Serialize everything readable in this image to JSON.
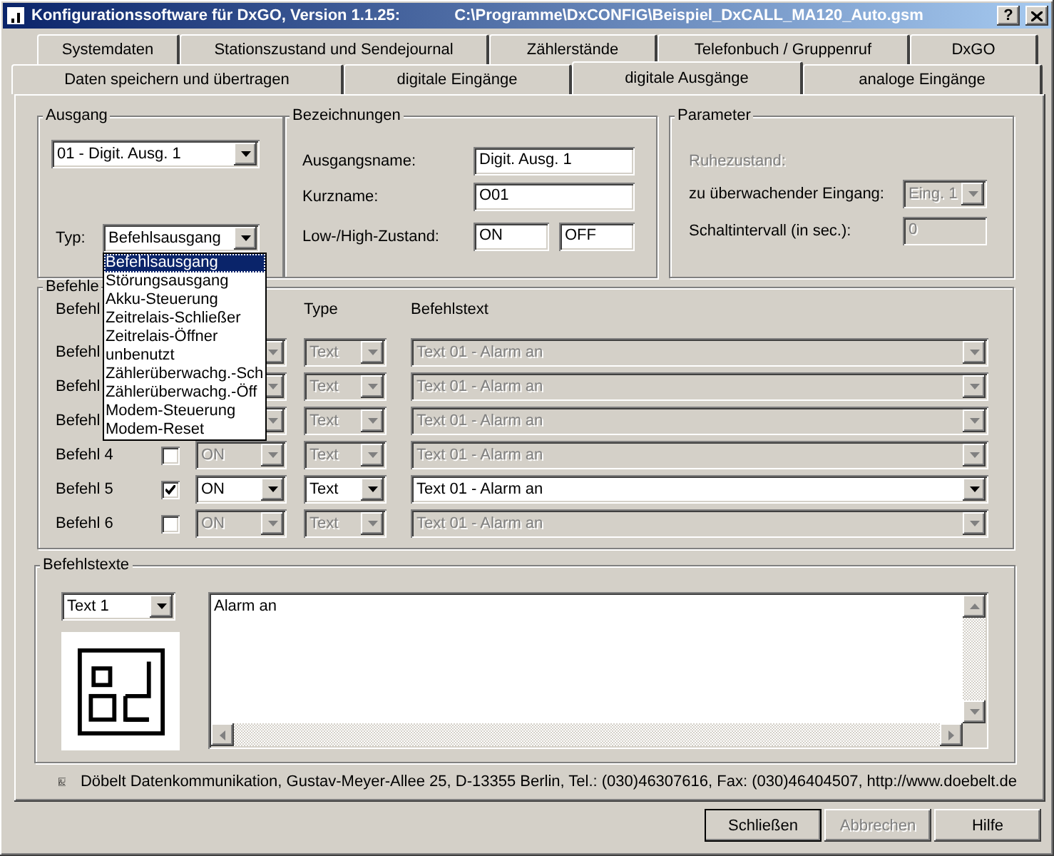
{
  "window": {
    "title": "Konfigurationssoftware für DxGO, Version 1.1.25:",
    "path": "C:\\Programme\\DxCONFIG\\Beispiel_DxCALL_MA120_Auto.gsm",
    "controls": [
      {
        "kind": "help",
        "label": "?"
      },
      {
        "kind": "close"
      }
    ]
  },
  "tabs": [
    [
      {
        "label": "Systemdaten",
        "selected": false
      },
      {
        "label": "Stationszustand und Sendejournal",
        "selected": false
      },
      {
        "label": "Zählerstände",
        "selected": false
      },
      {
        "label": "Telefonbuch / Gruppenruf",
        "selected": false
      },
      {
        "label": "DxGO",
        "selected": false
      }
    ],
    [
      {
        "label": "Daten speichern und übertragen",
        "selected": false
      },
      {
        "label": "digitale Eingänge",
        "selected": false
      },
      {
        "label": "digitale Ausgänge",
        "selected": true
      },
      {
        "label": "analoge Eingänge",
        "selected": false
      }
    ]
  ],
  "ausgang": {
    "title": "Ausgang",
    "output": "01 - Digit. Ausg. 1",
    "type_label": "Typ:",
    "type": "Befehlsausgang",
    "type_expanded": true,
    "type_options": [
      {
        "label": "Befehlsausgang",
        "selected": true
      },
      {
        "label": "Störungsausgang",
        "selected": false
      },
      {
        "label": "Akku-Steuerung",
        "selected": false
      },
      {
        "label": "Zeitrelais-Schließer",
        "selected": false
      },
      {
        "label": "Zeitrelais-Öffner",
        "selected": false
      },
      {
        "label": "unbenutzt",
        "selected": false
      },
      {
        "label": "Zählerüberwachg.-Sch",
        "selected": false
      },
      {
        "label": "Zählerüberwachg.-Öff",
        "selected": false
      },
      {
        "label": "Modem-Steuerung",
        "selected": false
      },
      {
        "label": "Modem-Reset",
        "selected": false
      }
    ]
  },
  "bezeichnungen": {
    "title": "Bezeichnungen",
    "fields": [
      {
        "label": "Ausgangsname:",
        "values": [
          "Digit. Ausg. 1"
        ]
      },
      {
        "label": "Kurzname:",
        "values": [
          "O01"
        ]
      },
      {
        "label": "Low-/High-Zustand:",
        "values": [
          "ON",
          "OFF"
        ]
      }
    ]
  },
  "parameter": {
    "title": "Parameter",
    "rows": [
      {
        "kind": "heading",
        "label": "Ruhezustand:",
        "disabled": true
      },
      {
        "kind": "select",
        "label": "zu überwachender Eingang:",
        "value": "Eing. 1",
        "disabled": true
      },
      {
        "kind": "input",
        "label": "Schaltintervall (in sec.):",
        "value": "0",
        "disabled": true
      }
    ]
  },
  "befehle": {
    "title": "Befehle",
    "headers": {
      "label": "Befehl",
      "type": "Type",
      "text": "Befehlstext"
    },
    "rows": [
      {
        "label": "Befehl",
        "type": "Text",
        "text": "Text 01 - Alarm an",
        "disabled": true
      },
      {
        "label": "Befehl",
        "type": "Text",
        "text": "Text 01 - Alarm an",
        "disabled": true
      },
      {
        "label": "Befehl",
        "type": "Text",
        "text": "Text 01 - Alarm an",
        "disabled": true
      },
      {
        "label": "Befehl 4",
        "checked": false,
        "state": "ON",
        "type": "Text",
        "text": "Text 01 - Alarm an",
        "disabled": true
      },
      {
        "label": "Befehl 5",
        "checked": true,
        "state": "ON",
        "type": "Text",
        "text": "Text 01 - Alarm an",
        "disabled": false
      },
      {
        "label": "Befehl 6",
        "checked": false,
        "state": "ON",
        "type": "Text",
        "text": "Text 01 - Alarm an",
        "disabled": true
      }
    ]
  },
  "befehlstexte": {
    "title": "Befehlstexte",
    "selector": "Text 1",
    "text": "Alarm an"
  },
  "footer": "Döbelt Datenkommunikation, Gustav-Meyer-Allee 25, D-13355 Berlin, Tel.: (030)46307616, Fax: (030)46404507, http://www.doebelt.de",
  "buttons": [
    {
      "label": "Schließen",
      "disabled": false,
      "default": true
    },
    {
      "label": "Abbrechen",
      "disabled": true,
      "default": false
    },
    {
      "label": "Hilfe",
      "disabled": false,
      "default": false
    }
  ]
}
